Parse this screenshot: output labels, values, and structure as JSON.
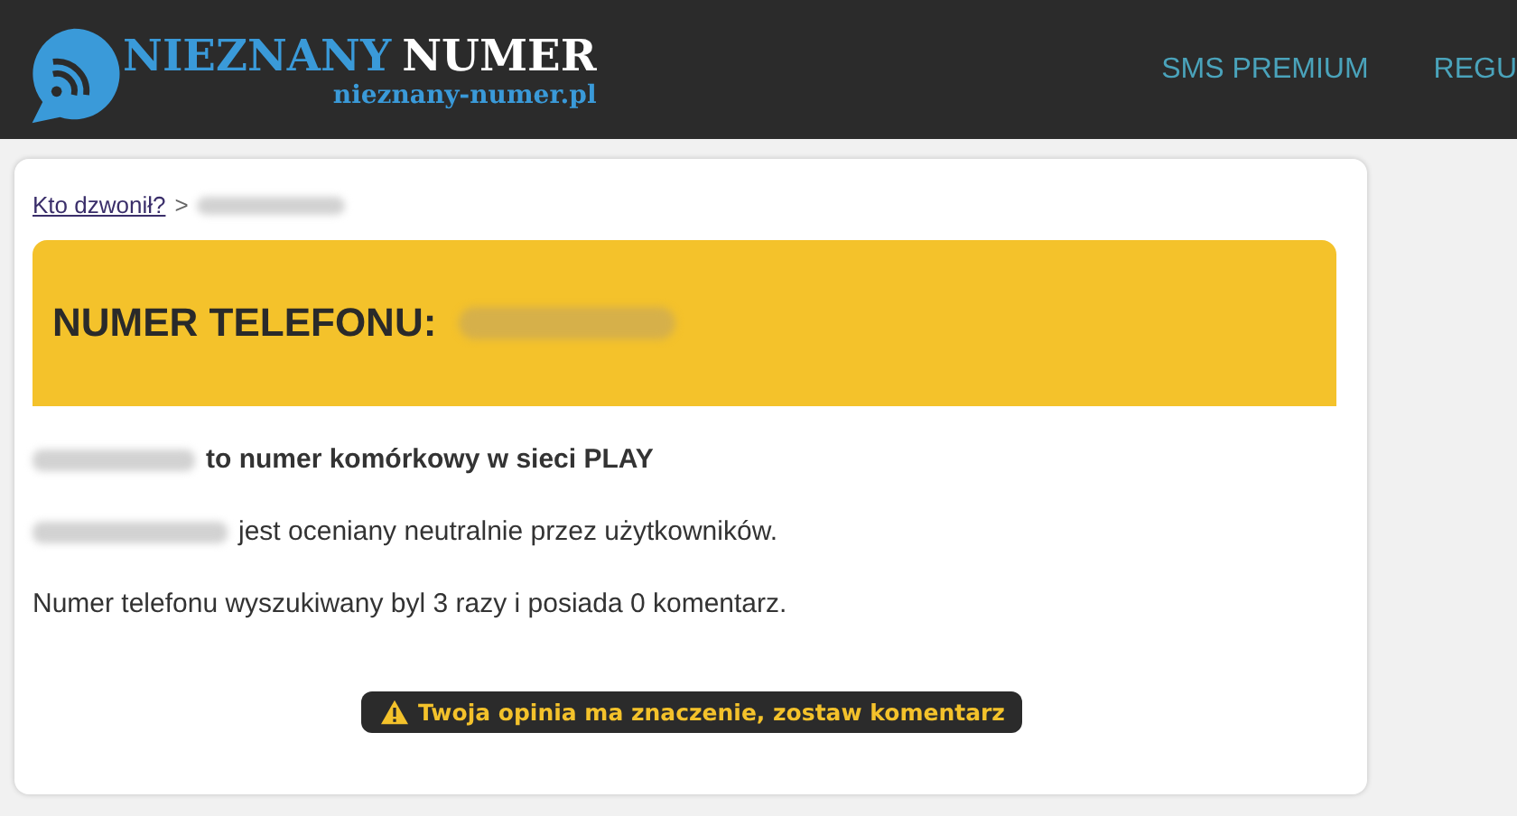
{
  "header": {
    "logo": {
      "word_1": "NIEZNANY",
      "word_2": "NUMER",
      "domain": "nieznany-numer.pl"
    },
    "nav": [
      {
        "label": "SMS PREMIUM"
      },
      {
        "label": "REGU"
      }
    ]
  },
  "breadcrumb": {
    "link": "Kto dzwonił?",
    "separator": ">"
  },
  "banner": {
    "title": "NUMER TELEFONU:"
  },
  "facts": [
    {
      "kind": "bold",
      "text": "to numer komórkowy w sieci PLAY"
    },
    {
      "kind": "plain",
      "text": "jest oceniany neutralnie przez użytkowników."
    },
    {
      "kind": "sentence",
      "text": "Numer telefonu wyszukiwany byl 3 razy i posiada 0 komentarz."
    }
  ],
  "comment_button": {
    "label": "Twoja opinia ma znaczenie, zostaw komentarz"
  }
}
